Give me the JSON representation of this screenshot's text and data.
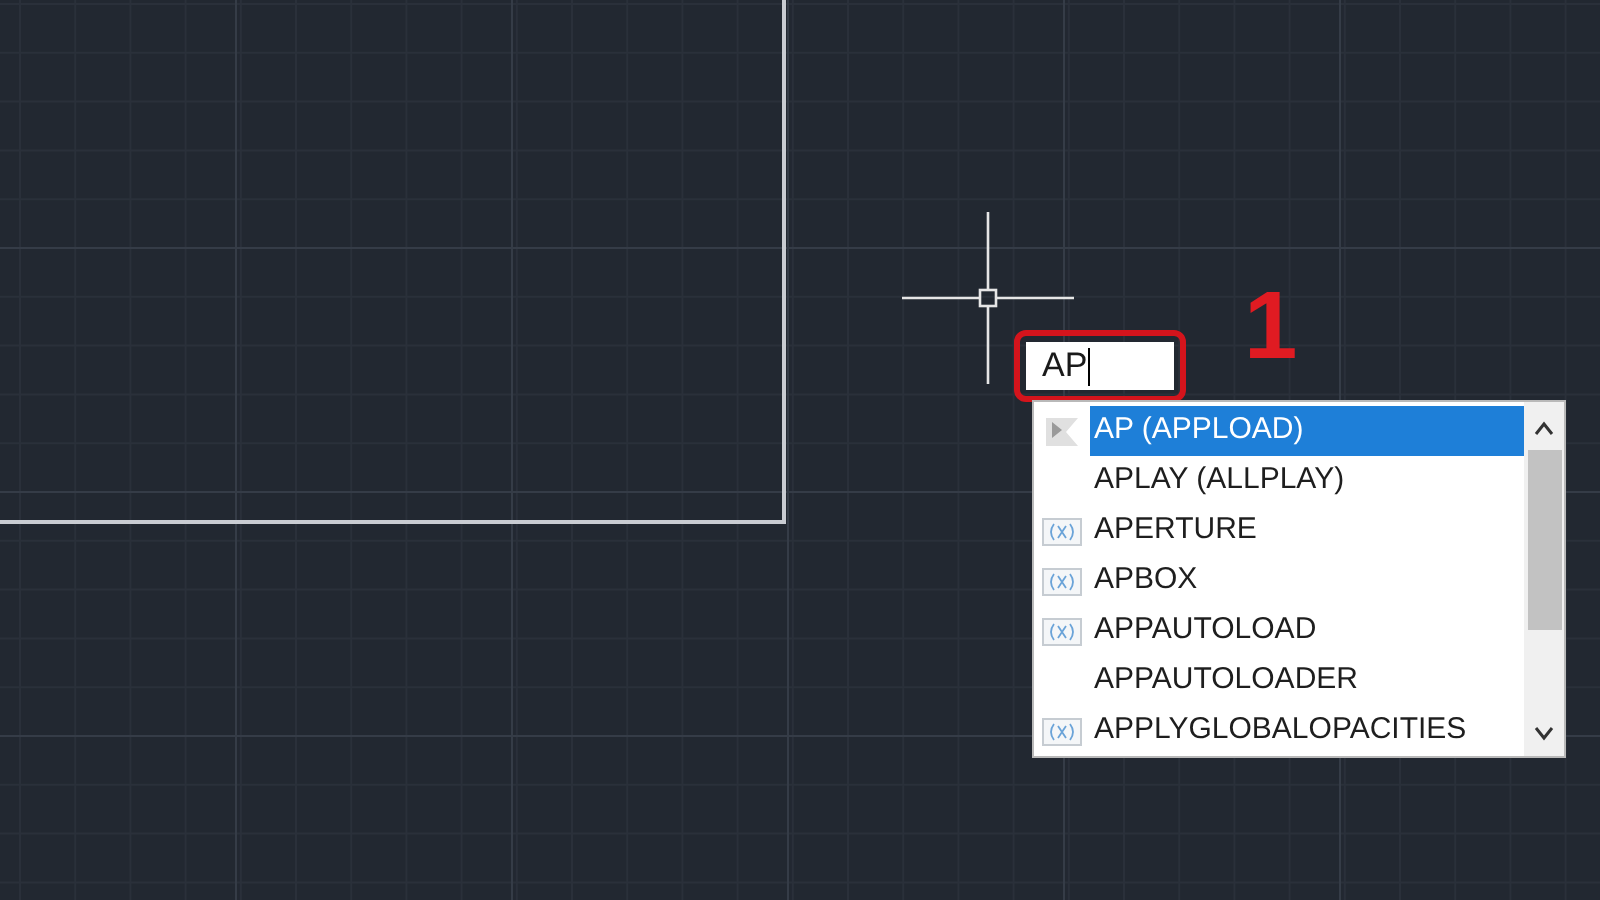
{
  "command_input": {
    "value": "AP"
  },
  "step_label": "1",
  "suggestions": [
    {
      "label": "AP (APPLOAD)",
      "selected": true,
      "kind": "flag"
    },
    {
      "label": "APLAY (ALLPLAY)",
      "selected": false,
      "kind": "plain"
    },
    {
      "label": "APERTURE",
      "selected": false,
      "kind": "variable"
    },
    {
      "label": "APBOX",
      "selected": false,
      "kind": "variable"
    },
    {
      "label": "APPAUTOLOAD",
      "selected": false,
      "kind": "variable"
    },
    {
      "label": "APPAUTOLOADER",
      "selected": false,
      "kind": "plain"
    },
    {
      "label": "APPLYGLOBALOPACITIES",
      "selected": false,
      "kind": "variable"
    }
  ]
}
